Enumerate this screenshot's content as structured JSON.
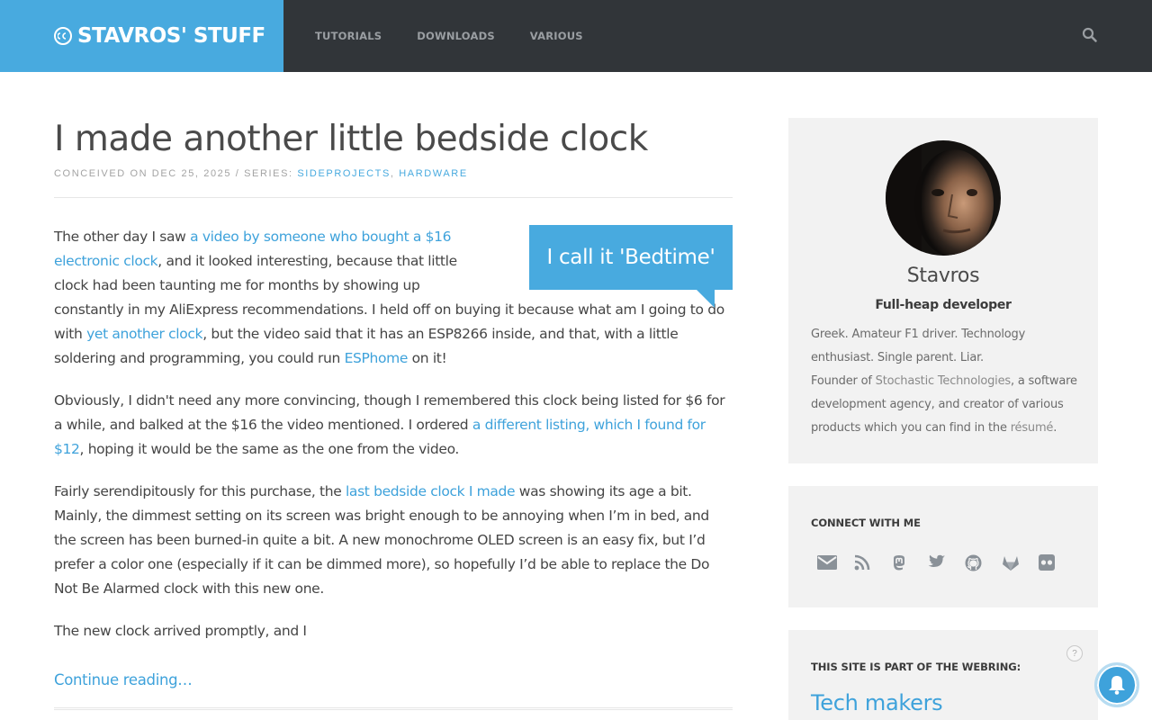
{
  "header": {
    "site_name": "STAVROS' STUFF",
    "nav": [
      "TUTORIALS",
      "DOWNLOADS",
      "VARIOUS"
    ]
  },
  "post": {
    "title": "I made another little bedside clock",
    "meta_prefix": "CONCEIVED ON DEC 25, 2025 / SERIES: ",
    "series": [
      "SIDEPROJECTS",
      "HARDWARE"
    ],
    "series_separator": ", ",
    "callout": "I call it 'Bedtime'",
    "p1": {
      "t1": "The other day I saw ",
      "link1": "a video by someone who bought a $16 electronic clock",
      "t2": ", and it looked interesting, because that little clock had been taunting me for months by showing up constantly in my AliExpress recommendations. I held off on buying it because what am I going to do with ",
      "link2": "yet another clock",
      "t3": ", but the video said that it has an ESP8266 inside, and that, with a little soldering and programming, you could run ",
      "link3": "ESPhome",
      "t4": " on it!"
    },
    "p2": {
      "t1": "Obviously, I didn't need any more convincing, though I remembered this clock being listed for $6 for a while, and balked at the $16 the video mentioned. I ordered ",
      "link1": "a different listing, which I found for $12",
      "t2": ", hoping it would be the same as the one from the video."
    },
    "p3": {
      "t1": "Fairly serendipitously for this purchase, the ",
      "link1": "last bedside clock I made",
      "t2": " was showing its age a bit. Mainly, the dimmest setting on its screen was bright enough to be annoying when I’m in bed, and the screen has been burned-in quite a bit. A new monochrome OLED screen is an easy fix, but I’d prefer a color one (especially if it can be dimmed more), so hopefully I’d be able to replace the Do Not Be Alarmed clock with this new one."
    },
    "p4": "The new clock arrived promptly, and I",
    "continue": "Continue reading…"
  },
  "sidebar": {
    "profile": {
      "name": "Stavros",
      "tagline": "Full-heap developer",
      "bio_line1": "Greek. Amateur F1 driver. Technology enthusiast. Single parent. Liar.",
      "bio_t1": "Founder of ",
      "bio_link1": "Stochastic Technologies",
      "bio_t2": ", a software development agency, and creator of various products which you can find in the ",
      "bio_link2": "résumé",
      "bio_t3": "."
    },
    "connect": {
      "heading": "CONNECT WITH ME",
      "icons": [
        "email-icon",
        "rss-icon",
        "mastodon-icon",
        "twitter-icon",
        "github-icon",
        "gitlab-icon",
        "flickr-icon"
      ]
    },
    "webring": {
      "heading": "THIS SITE IS PART OF THE WEBRING:",
      "help": "?",
      "name": "Tech makers"
    }
  },
  "colors": {
    "accent": "#48aadf",
    "header_bg": "#313539",
    "panel_bg": "#f2f2f2"
  }
}
